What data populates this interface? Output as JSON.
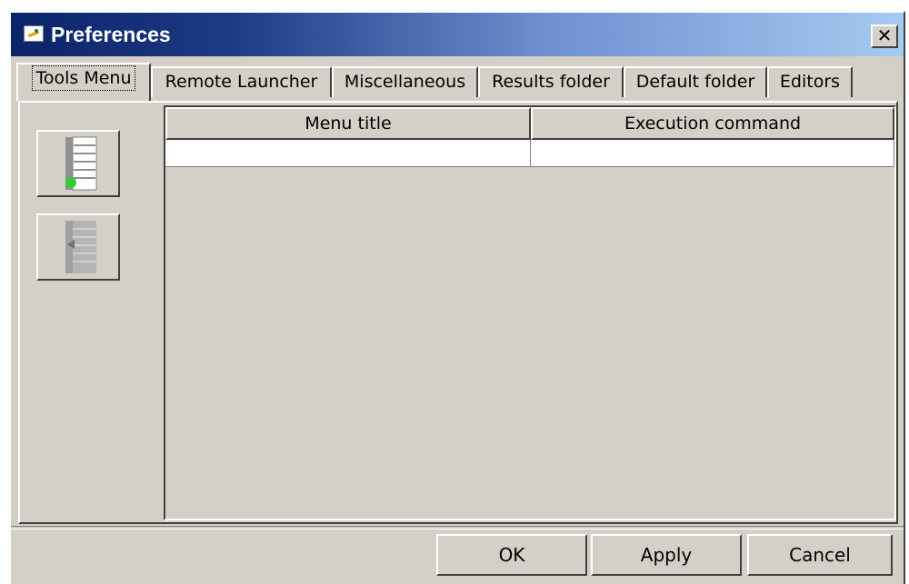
{
  "window": {
    "title": "Preferences",
    "close_label": "✕"
  },
  "tabs": [
    {
      "label": "Tools Menu",
      "active": true
    },
    {
      "label": "Remote Launcher",
      "active": false
    },
    {
      "label": "Miscellaneous",
      "active": false
    },
    {
      "label": "Results folder",
      "active": false
    },
    {
      "label": "Default folder",
      "active": false
    },
    {
      "label": "Editors",
      "active": false
    }
  ],
  "side_buttons": [
    {
      "name": "add-menu-item",
      "icon": "list-add-icon",
      "enabled": true
    },
    {
      "name": "remove-menu-item",
      "icon": "list-remove-icon",
      "enabled": false
    }
  ],
  "table": {
    "columns": [
      "Menu title",
      "Execution command"
    ],
    "rows": [
      [
        "",
        ""
      ]
    ]
  },
  "buttons": {
    "ok": "OK",
    "apply": "Apply",
    "cancel": "Cancel"
  },
  "colors": {
    "titlebar_start": "#0a246a",
    "titlebar_end": "#a6caf0",
    "face": "#d4d0c8",
    "add_dot": "#33cc33"
  }
}
